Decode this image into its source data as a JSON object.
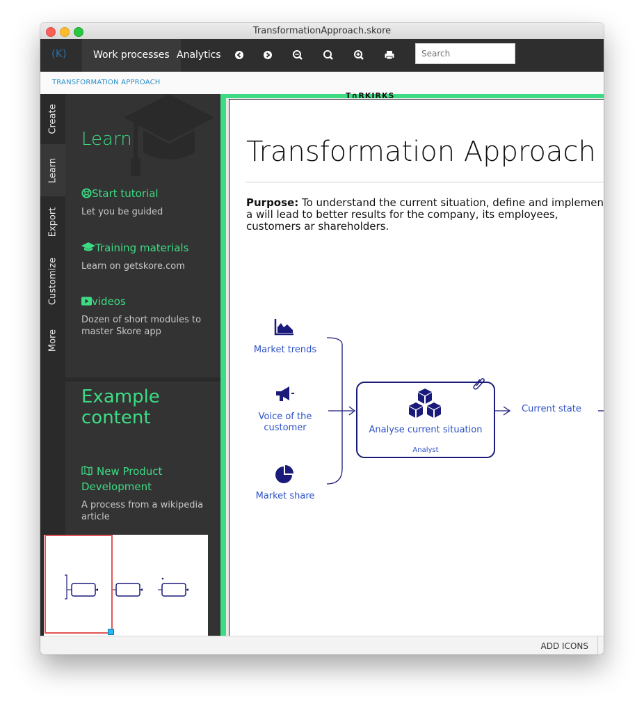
{
  "window": {
    "title": "TransformationApproach.skore"
  },
  "toolbar": {
    "logo": "(K)",
    "tabs": [
      {
        "label": "Work processes"
      },
      {
        "label": "Analytics"
      }
    ],
    "buttons": [
      "back-icon",
      "forward-icon",
      "zoom-out-icon",
      "zoom-reset-icon",
      "zoom-in-icon",
      "print-icon"
    ],
    "search_placeholder": "Search"
  },
  "breadcrumb": "TRANSFORMATION APPROACH",
  "vertical_tabs": [
    "Create",
    "Learn",
    "Export",
    "Customize",
    "More"
  ],
  "learn_panel": {
    "title": "Learn",
    "items": [
      {
        "title": "Start tutorial",
        "desc": "Let you be guided",
        "icon": "lifebuoy-icon"
      },
      {
        "title": "Training materials",
        "desc": "Learn on getskore.com",
        "icon": "graduation-cap-icon"
      },
      {
        "title": "videos",
        "desc": "Dozen of short modules to master Skore app",
        "icon": "video-icon"
      }
    ],
    "example_title": "Example content",
    "example_items": [
      {
        "title": "New Product Development",
        "desc": "A process from a wikipedia article",
        "icon": "map-icon"
      }
    ]
  },
  "document": {
    "title": "Transformation Approach",
    "purpose_label": "Purpose:",
    "purpose_text": " To understand the current situation, define and implement a will lead to better results for the company, its employees, customers ar shareholders.",
    "inputs": [
      {
        "label": "Market trends",
        "icon": "area-chart-icon"
      },
      {
        "label": "Voice of the customer",
        "icon": "megaphone-icon"
      },
      {
        "label": "Market share",
        "icon": "pie-chart-icon"
      }
    ],
    "process_box": {
      "title": "Analyse current situation",
      "role": "Analyst",
      "icon": "cubes-icon"
    },
    "output": "Current state",
    "top_fragment": "T∩RKIRKS"
  },
  "status": {
    "add_icons": "ADD ICONS"
  }
}
